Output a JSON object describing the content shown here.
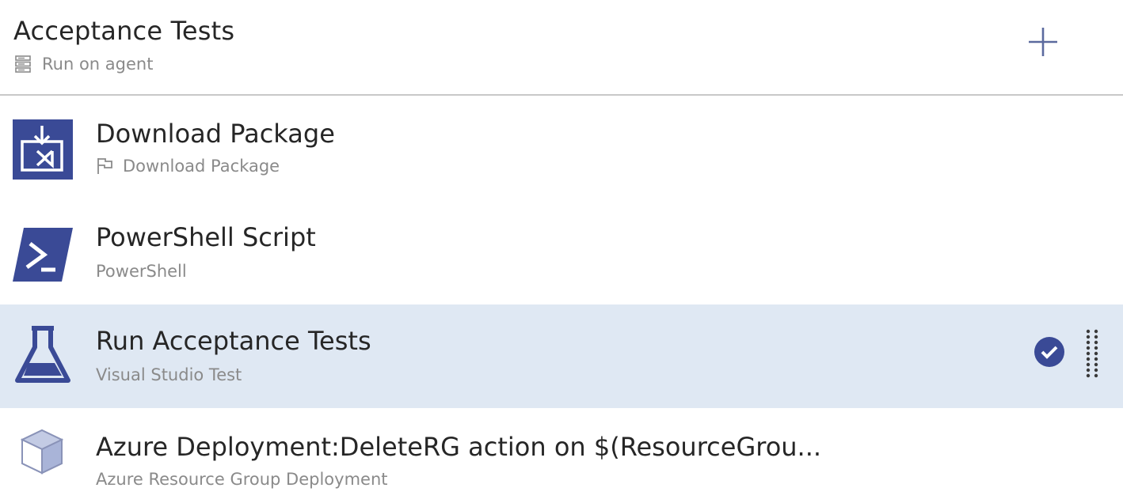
{
  "job": {
    "title": "Acceptance Tests",
    "subtitle": "Run on agent",
    "agent_icon": "server-icon",
    "add_icon": "plus-icon"
  },
  "tasks": [
    {
      "title": "Download Package",
      "subtitle": "Download Package",
      "icon": "download-package-icon",
      "sub_icon": "flag-icon",
      "selected": false
    },
    {
      "title": "PowerShell Script",
      "subtitle": "PowerShell",
      "icon": "powershell-icon",
      "selected": false
    },
    {
      "title": "Run Acceptance Tests",
      "subtitle": "Visual Studio Test",
      "icon": "flask-icon",
      "selected": true,
      "status_icon": "check-circle-icon",
      "handle_icon": "drag-handle-icon"
    },
    {
      "title": "Azure Deployment:DeleteRG action on $(ResourceGrou...",
      "subtitle": "Azure Resource Group Deployment",
      "icon": "azure-cube-icon",
      "selected": false
    }
  ],
  "colors": {
    "accent": "#3a4a96",
    "selected_bg": "#dfe8f3",
    "divider": "#c8c8c8",
    "muted_text": "#8a8a8a"
  }
}
